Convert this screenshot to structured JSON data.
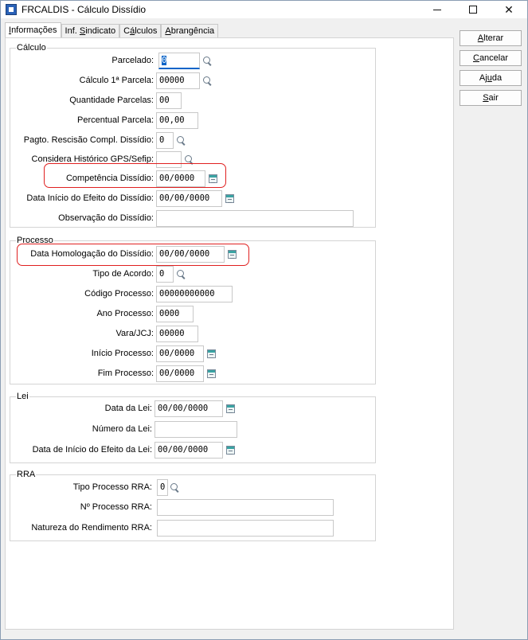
{
  "window": {
    "title": "FRCALDIS - Cálculo Dissídio"
  },
  "tabs": [
    {
      "label": "Informações",
      "ul": "I",
      "rest": "nformações"
    },
    {
      "label": "Inf. Sindicato",
      "pre": "Inf. ",
      "ul": "S",
      "rest": "indicato"
    },
    {
      "label": "Cálculos",
      "pre": "C",
      "ul": "á",
      "rest": "lculos"
    },
    {
      "label": "Abrangência",
      "ul": "A",
      "rest": "brangência"
    }
  ],
  "groups": {
    "calculo": {
      "title": "Cálculo",
      "parcelado": {
        "label": "Parcelado:",
        "value": "0"
      },
      "calculo_1_parcela": {
        "label": "Cálculo 1ª Parcela:",
        "value": "00000"
      },
      "quantidade_parcelas": {
        "label": "Quantidade Parcelas:",
        "value": "00"
      },
      "percentual_parcela": {
        "label": "Percentual Parcela:",
        "value": "00,00"
      },
      "pagto_rescisao": {
        "label": "Pagto. Rescisão Compl. Dissídio:",
        "value": "0"
      },
      "considera_historico": {
        "label": "Considera Histórico GPS/Sefip:",
        "value": ""
      },
      "competencia_dissidio": {
        "label": "Competência Dissídio:",
        "value": "00/0000"
      },
      "data_inicio_efeito": {
        "label": "Data Início do Efeito do Dissídio:",
        "value": "00/00/0000"
      },
      "observacao": {
        "label": "Observação do Dissídio:",
        "value": ""
      }
    },
    "processo": {
      "title": "Processo",
      "data_homologacao": {
        "label": "Data Homologação do Dissídio:",
        "value": "00/00/0000"
      },
      "tipo_acordo": {
        "label": "Tipo de Acordo:",
        "value": "0"
      },
      "codigo_processo": {
        "label": "Código Processo:",
        "value": "00000000000"
      },
      "ano_processo": {
        "label": "Ano Processo:",
        "value": "0000"
      },
      "vara_jcj": {
        "label": "Vara/JCJ:",
        "value": "00000"
      },
      "inicio_processo": {
        "label": "Início Processo:",
        "value": "00/0000"
      },
      "fim_processo": {
        "label": "Fim Processo:",
        "value": "00/0000"
      }
    },
    "lei": {
      "title": "Lei",
      "data_lei": {
        "label": "Data da Lei:",
        "value": "00/00/0000"
      },
      "numero_lei": {
        "label": "Número da Lei:",
        "value": ""
      },
      "data_inicio_efeito_lei": {
        "label": "Data de Início do Efeito da Lei:",
        "value": "00/00/0000"
      }
    },
    "rra": {
      "title": "RRA",
      "tipo_processo_rra": {
        "label": "Tipo Processo RRA:",
        "value": "0"
      },
      "numero_processo_rra": {
        "label": "Nº Processo RRA:",
        "value": ""
      },
      "natureza_rendimento_rra": {
        "label": "Natureza do Rendimento RRA:",
        "value": ""
      }
    }
  },
  "buttons": {
    "alterar": {
      "ul": "A",
      "rest": "lterar"
    },
    "cancelar": {
      "ul": "C",
      "rest": "ancelar"
    },
    "ajuda": {
      "pre": "Aj",
      "ul": "u",
      "rest": "da"
    },
    "sair": {
      "ul": "S",
      "rest": "air"
    }
  },
  "colors": {
    "highlight": "#e02020",
    "focus": "#0a64c8"
  }
}
